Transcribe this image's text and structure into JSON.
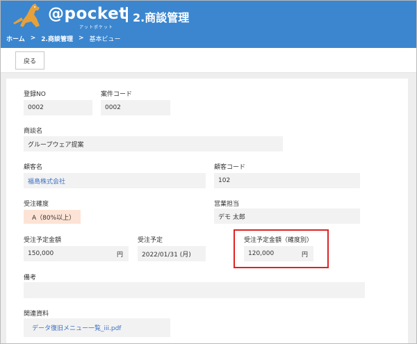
{
  "app": {
    "logo_text": "@pocket",
    "logo_sub": "アットポケット",
    "title": "2.商談管理"
  },
  "breadcrumb": {
    "home": "ホーム",
    "module": "2.商談管理",
    "current": "基本ビュー",
    "separator": ">"
  },
  "toolbar": {
    "back_label": "戻る"
  },
  "form": {
    "reg_no": {
      "label": "登録NO",
      "value": "0002"
    },
    "case_code": {
      "label": "案件コード",
      "value": "0002"
    },
    "deal_name": {
      "label": "商談名",
      "value": "グループウェア提案"
    },
    "customer_name": {
      "label": "顧客名",
      "value": "福島株式会社"
    },
    "customer_code": {
      "label": "顧客コード",
      "value": "102"
    },
    "order_probability": {
      "label": "受注確度",
      "value": "A（80%以上）"
    },
    "sales_rep": {
      "label": "営業担当",
      "value": "デモ 太郎"
    },
    "expected_amount": {
      "label": "受注予定金額",
      "value": "150,000",
      "unit": "円"
    },
    "expected_date": {
      "label": "受注予定",
      "value": "2022/01/31 (月)"
    },
    "weighted_amount": {
      "label": "受注予定金額（確度別）",
      "value": "120,000",
      "unit": "円"
    },
    "notes": {
      "label": "備考",
      "value": ""
    },
    "attachments": {
      "label": "関連資料",
      "value": "データ復旧メニュー一覧_iii.pdf"
    }
  },
  "colors": {
    "header": "#3b86cf",
    "highlight": "#e02020",
    "probability_bg": "#fde3d5",
    "link": "#3b6fc4"
  }
}
